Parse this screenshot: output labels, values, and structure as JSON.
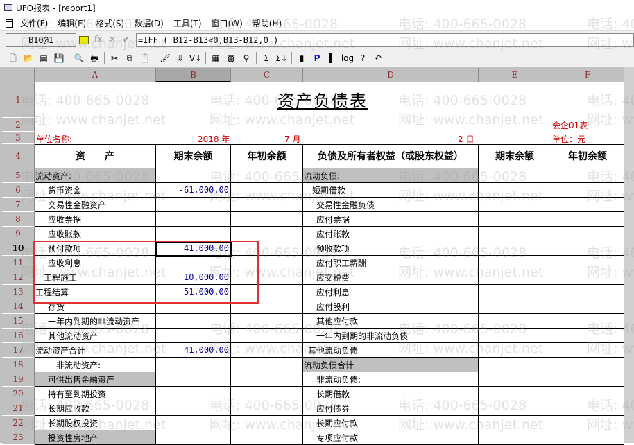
{
  "window": {
    "title": "UFO报表 - [report1]"
  },
  "menu": [
    "文件(F)",
    "编辑(E)",
    "格式(S)",
    "数据(D)",
    "工具(T)",
    "窗口(W)",
    "帮助(H)"
  ],
  "formula_bar": {
    "cell_ref": "B10@1",
    "formula": "=IFF ( B12-B13<0,B13-B12,0 )"
  },
  "toolbar_icons": [
    "new-icon",
    "open-icon",
    "blank-icon",
    "save-icon",
    "preview-icon",
    "print-icon",
    "cut-icon",
    "copy-icon",
    "paste-icon",
    "format-brush-icon",
    "insert-icon",
    "sort-icon",
    "table-icon",
    "grid-icon",
    "find-icon",
    "sum-icon",
    "sum-down-icon",
    "chart-icon",
    "p-icon",
    "book-icon",
    "log-icon",
    "help-icon",
    "undo-icon"
  ],
  "columns": [
    "A",
    "B",
    "C",
    "D",
    "E",
    "F"
  ],
  "report": {
    "title": "资产负债表",
    "company_label": "单位名称:",
    "year": "2018 年",
    "month": "7 月",
    "day": "2 日",
    "form_code": "会企01表",
    "unit": "单位：元",
    "headers": [
      "资　　产",
      "期末余额",
      "年初余额",
      "负债及所有者权益（或股东权益）",
      "期末余额",
      "年初余额"
    ]
  },
  "rows": [
    {
      "n": "5",
      "a": "流动资产:",
      "b": "",
      "d": "流动负债:",
      "ga": true,
      "gd": true,
      "ia": 0,
      "id": 0
    },
    {
      "n": "6",
      "a": "货币资金",
      "b": "-61,000.00",
      "d": "短期借款",
      "ia": 3,
      "id": 2
    },
    {
      "n": "7",
      "a": "交易性金融资产",
      "b": "",
      "d": "交易性金融负债",
      "ia": 3,
      "id": 3
    },
    {
      "n": "8",
      "a": "应收票据",
      "b": "",
      "d": "应付票据",
      "ia": 3,
      "id": 3
    },
    {
      "n": "9",
      "a": "应收账款",
      "b": "",
      "d": "应付账款",
      "ia": 3,
      "id": 3
    },
    {
      "n": "10",
      "a": "预付款项",
      "b": "41,000.00",
      "d": "预收款项",
      "ia": 3,
      "id": 3
    },
    {
      "n": "11",
      "a": "应收利息",
      "b": "",
      "d": "应付职工薪酬",
      "ia": 3,
      "id": 3
    },
    {
      "n": "12",
      "a": "工程施工",
      "b": "10,000.00",
      "d": "应交税费",
      "ia": 2,
      "id": 3
    },
    {
      "n": "13",
      "a": "工程结算",
      "b": "51,000.00",
      "d": "应付利息",
      "ia": 0,
      "id": 3
    },
    {
      "n": "14",
      "a": "存货",
      "b": "",
      "d": "应付股利",
      "ia": 3,
      "id": 3
    },
    {
      "n": "15",
      "a": "一年内到期的非流动资产",
      "b": "",
      "d": "其他应付款",
      "ia": 3,
      "id": 3
    },
    {
      "n": "16",
      "a": "其他流动资产",
      "b": "",
      "d": "一年内到期的非流动负债",
      "ia": 3,
      "id": 3
    },
    {
      "n": "17",
      "a": "流动资产合计",
      "b": "41,000.00",
      "d": "其他流动负债",
      "ia": 0,
      "id": 1
    },
    {
      "n": "18",
      "a": "非流动资产:",
      "b": "",
      "d": "流动负债合计",
      "gd": true,
      "ia": 5,
      "id": 0
    },
    {
      "n": "19",
      "a": "可供出售金融资产",
      "b": "",
      "d": "非流动负债:",
      "ga": true,
      "ia": 3,
      "id": 3
    },
    {
      "n": "20",
      "a": "持有至到期投资",
      "b": "",
      "d": "长期借款",
      "ia": 3,
      "id": 3
    },
    {
      "n": "21",
      "a": "长期应收款",
      "b": "",
      "d": "应付债券",
      "ia": 3,
      "id": 3
    },
    {
      "n": "22",
      "a": "长期股权投资",
      "b": "",
      "d": "长期应付款",
      "ia": 3,
      "id": 3
    },
    {
      "n": "23",
      "a": "投资性房地产",
      "b": "",
      "d": "专项应付款",
      "ga": true,
      "ia": 3,
      "id": 3
    }
  ],
  "watermark": {
    "phone": "电话: 400-665-0028",
    "site": "网址: www.chanjet.net"
  }
}
